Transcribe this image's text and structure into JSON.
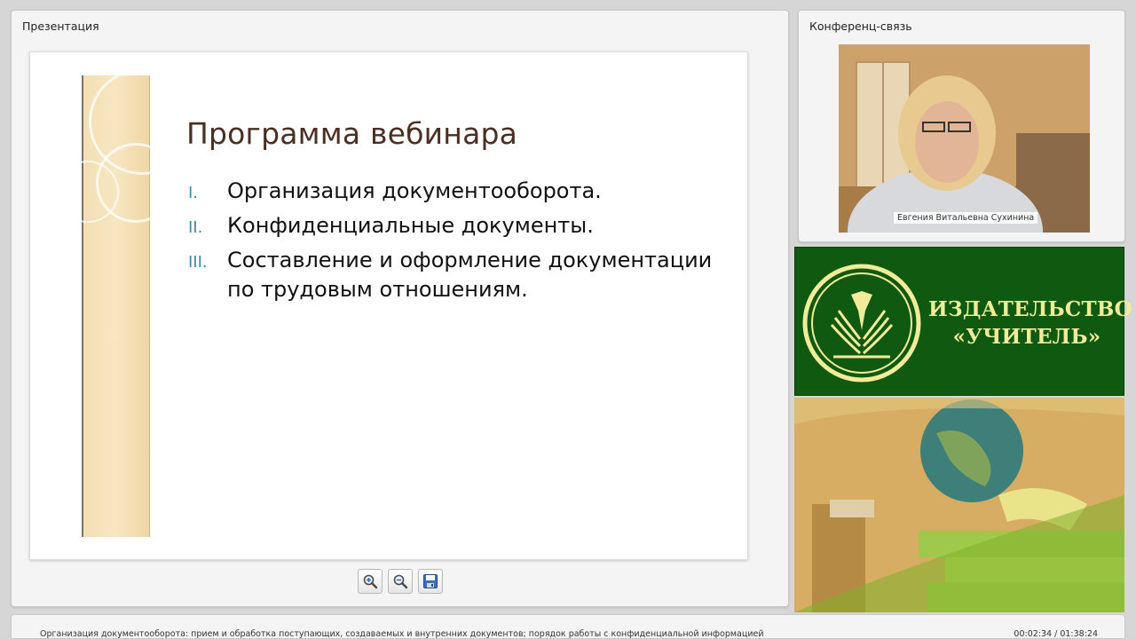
{
  "presentation": {
    "title": "Презентация",
    "slide": {
      "title": "Программа вебинара",
      "items": [
        {
          "num": "I.",
          "text": "Организация документооборота."
        },
        {
          "num": "II.",
          "text": "Конфиденциальные документы."
        },
        {
          "num": "III.",
          "text": "Составление и оформление документации по трудовым отношениям."
        }
      ]
    },
    "toolbar": {
      "icons": [
        "zoom-in-icon",
        "zoom-out-icon",
        "save-icon"
      ]
    }
  },
  "conference": {
    "title": "Конференц-связь",
    "speaker_name": "Евгения Витальевна Сухинина"
  },
  "publisher": {
    "line1": "ИЗДАТЕЛЬСТВО",
    "line2": "«УЧИТЕЛЬ»"
  },
  "footer": {
    "description": "Организация документооборота: прием и обработка поступающих, создаваемых и внутренних документов; порядок работы с конфиденциальной информацией",
    "time": "00:02:34 / 01:38:24"
  },
  "colors": {
    "publisher_green": "#0f5a10",
    "publisher_text": "#f2ec9a",
    "slide_title": "#4a2f22",
    "numbering": "#3d8aa6"
  }
}
